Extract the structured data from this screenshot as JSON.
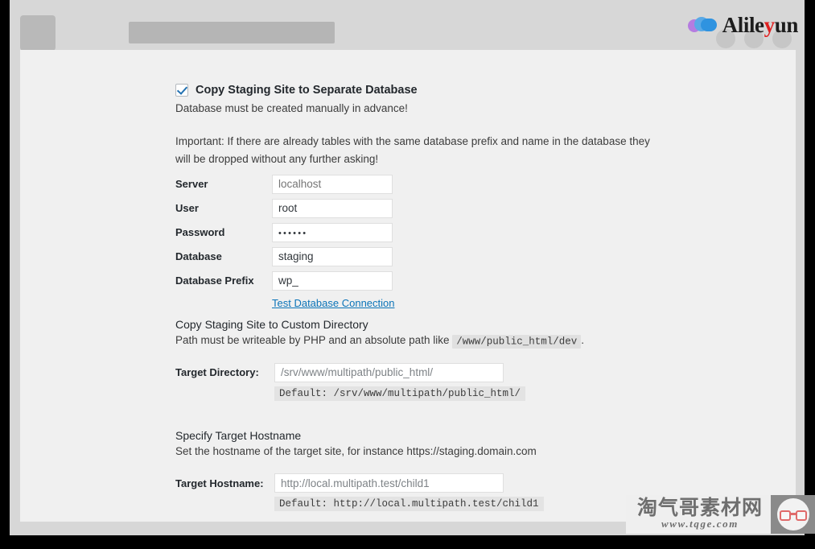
{
  "browser": {
    "logo_text_prefix": "Alile",
    "logo_text_highlight": "y",
    "logo_text_suffix": "un",
    "logo_icon": "cloud-icon",
    "accent_red": "#e02020",
    "placeholder_block_color": "#b9b9b9"
  },
  "database_section": {
    "checkbox_label": "Copy Staging Site to Separate Database",
    "checkbox_checked": true,
    "subtitle": "Database must be created manually in advance!",
    "important_note": "Important: If there are already tables with the same database prefix and name in the database they will be dropped without any further asking!",
    "fields": [
      {
        "label": "Server",
        "value": "",
        "placeholder": "localhost",
        "type": "text",
        "is_placeholder": true
      },
      {
        "label": "User",
        "value": "root",
        "placeholder": "",
        "type": "text",
        "is_placeholder": false
      },
      {
        "label": "Password",
        "value": "••••••",
        "placeholder": "",
        "type": "password",
        "is_placeholder": false
      },
      {
        "label": "Database",
        "value": "staging",
        "placeholder": "",
        "type": "text",
        "is_placeholder": false
      },
      {
        "label": "Database Prefix",
        "value": "wp_",
        "placeholder": "",
        "type": "text",
        "is_placeholder": false
      }
    ],
    "test_connection_link": "Test Database Connection",
    "link_color": "#0b74b8"
  },
  "directory_section": {
    "heading": "Copy Staging Site to Custom Directory",
    "description_before": "Path must be writeable by PHP and an absolute path like",
    "description_code": "/www/public_html/dev",
    "description_after": ".",
    "field_label": "Target Directory:",
    "field_value": "/srv/www/multipath/public_html/",
    "default_text": "Default: /srv/www/multipath/public_html/"
  },
  "hostname_section": {
    "heading": "Specify Target Hostname",
    "description": "Set the hostname of the target site, for instance https://staging.domain.com",
    "field_label": "Target Hostname:",
    "field_value": "http://local.multipath.test/child1",
    "default_text": "Default: http://local.multipath.test/child1"
  },
  "watermark": {
    "chinese": "淘气哥素材网",
    "url": "www.tqge.com",
    "icon": "glasses-face-icon"
  }
}
